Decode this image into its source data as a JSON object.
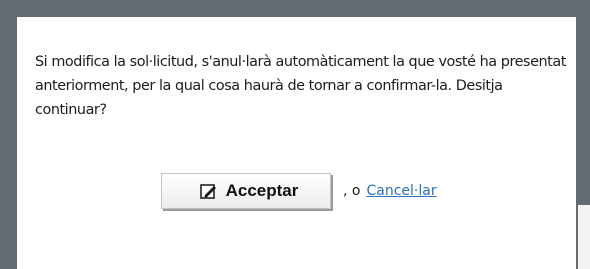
{
  "dialog": {
    "message": "Si modifica la sol·licitud, s'anul·larà automàticament la que vosté ha presentat anteriorment, per la qual cosa haurà de tornar a confirmar-la. Desitja continuar?",
    "accept_label": "Acceptar",
    "accept_icon": "edit-icon",
    "separator": ", o",
    "cancel_label": "Cancel·lar"
  },
  "colors": {
    "frame": "#646a72",
    "background": "#ffffff",
    "link": "#2b6fbf",
    "text": "#1c1c1c"
  }
}
